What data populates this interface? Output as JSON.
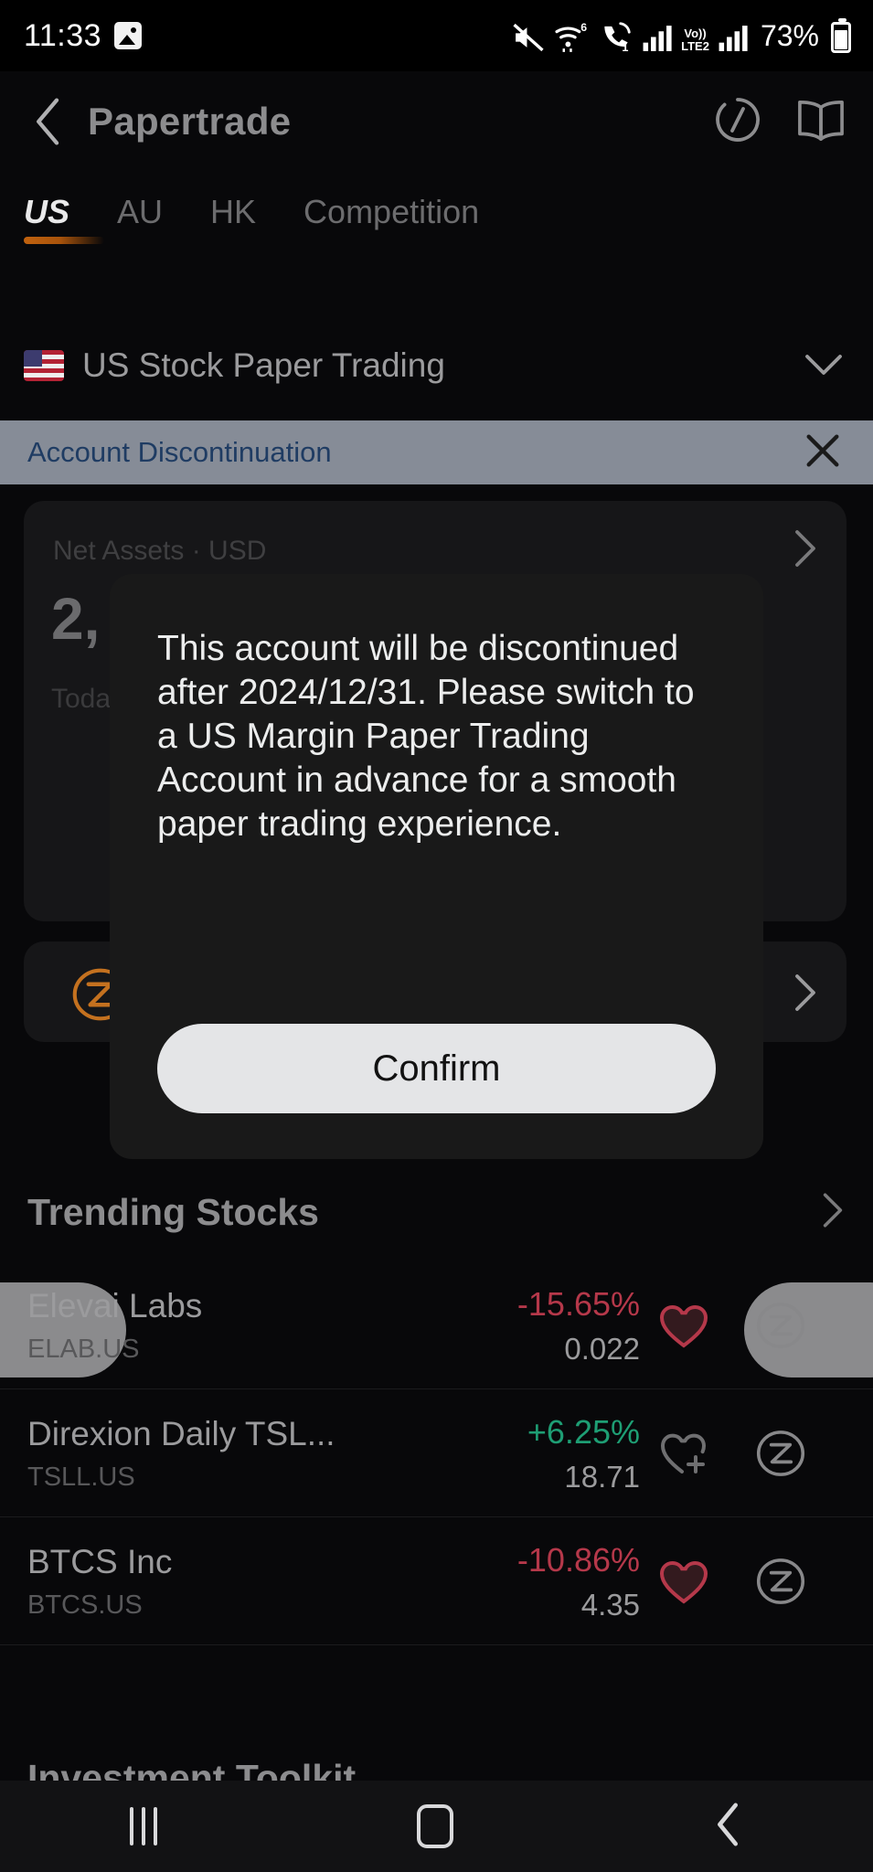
{
  "status_bar": {
    "time": "11:33",
    "battery_percent": "73%",
    "icons": [
      "image-icon",
      "mute-icon",
      "wifi-6-icon",
      "call-icon",
      "signal-1-icon",
      "volte-lte2-icon",
      "signal-2-icon",
      "battery-icon"
    ],
    "lte_label_top": "Vo))",
    "lte_label_bottom": "LTE2",
    "wifi_gen": "6",
    "sim_one": "1"
  },
  "header": {
    "title": "Papertrade",
    "back_icon": "chevron-left-icon",
    "refresh_icon": "refresh-circle-icon",
    "book_icon": "book-icon"
  },
  "tabs": [
    {
      "label": "US",
      "active": true
    },
    {
      "label": "AU",
      "active": false
    },
    {
      "label": "HK",
      "active": false
    },
    {
      "label": "Competition",
      "active": false
    }
  ],
  "account": {
    "flag_icon": "us-flag-icon",
    "name": "US Stock Paper Trading",
    "chevron_icon": "chevron-down-icon"
  },
  "banner": {
    "text": "Account Discontinuation",
    "close_icon": "close-icon",
    "background_color": "#868c97",
    "text_color": "#1f3c63"
  },
  "assets_card": {
    "label": "Net Assets · USD",
    "value": "2,",
    "sub_label": "Toda",
    "chevron_icon": "chevron-right-icon"
  },
  "promo_card": {
    "logo_icon": "moomoo-z-logo-icon",
    "logo_color": "#c4711f",
    "chevron_icon": "chevron-right-icon"
  },
  "modal": {
    "message": "This account will be discontinued after 2024/12/31. Please switch to a US Margin Paper Trading Account in advance for a smooth paper trading experience.",
    "confirm_label": "Confirm",
    "confirm_bg": "#e4e5e7",
    "confirm_text_color": "#121212"
  },
  "trending": {
    "title": "Trending Stocks",
    "chevron_icon": "chevron-right-icon",
    "rows": [
      {
        "name": "Elevai Labs",
        "code": "ELAB.US",
        "change_pct": "-15.65%",
        "price": "0.022",
        "direction": "down",
        "heart_icon": "heart-filled-icon",
        "favorited": true,
        "trade_icon": "moomoo-z-icon"
      },
      {
        "name": "Direxion Daily TSL...",
        "code": "TSLL.US",
        "change_pct": "+6.25%",
        "price": "18.71",
        "direction": "up",
        "heart_icon": "heart-plus-outline-icon",
        "favorited": false,
        "trade_icon": "moomoo-z-icon"
      },
      {
        "name": "BTCS Inc",
        "code": "BTCS.US",
        "change_pct": "-10.86%",
        "price": "4.35",
        "direction": "down",
        "heart_icon": "heart-filled-icon",
        "favorited": true,
        "trade_icon": "moomoo-z-icon"
      }
    ]
  },
  "toolkit": {
    "title": "Investment Toolkit"
  },
  "nav_bar": {
    "recents_icon": "recents-icon",
    "home_icon": "home-icon",
    "back_icon": "back-icon"
  },
  "colors": {
    "up": "#1e9e74",
    "down": "#b5384a",
    "accent": "#c1620f",
    "background": "#08080a"
  }
}
